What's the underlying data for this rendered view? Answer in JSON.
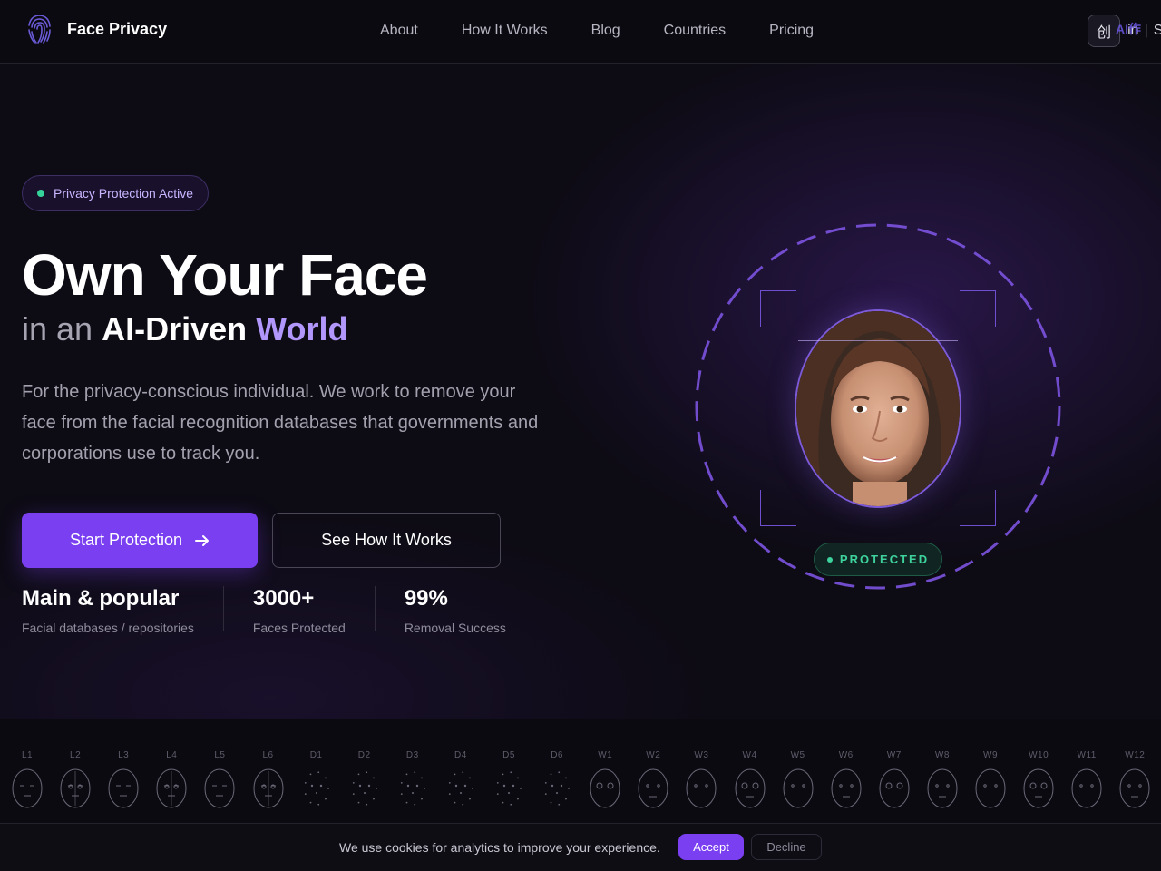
{
  "nav": {
    "brand": "Face Privacy",
    "links": [
      "About",
      "How It Works",
      "Blog",
      "Countries",
      "Pricing"
    ],
    "app_badge": "创",
    "signin": "in",
    "signup": "Sign up",
    "ai_mark": "AI作"
  },
  "hero": {
    "status": "Privacy Protection Active",
    "title": "Own Your Face",
    "subtitle_prefix": "in an",
    "subtitle_word1": "AI-Driven",
    "subtitle_word2": "World",
    "lead": "For the privacy-conscious individual. We work to remove your face from the facial recognition databases that governments and corporations use to track you.",
    "primary_cta": "Start Protection",
    "secondary_cta": "See How It Works",
    "stats": [
      {
        "value": "Main & popular",
        "label": "Facial databases / repositories"
      },
      {
        "value": "3000+",
        "label": "Faces Protected"
      },
      {
        "value": "99%",
        "label": "Removal Success"
      }
    ],
    "protected_badge": "PROTECTED"
  },
  "strip": {
    "labels": [
      "L1",
      "L2",
      "L3",
      "L4",
      "L5",
      "L6",
      "D1",
      "D2",
      "D3",
      "D4",
      "D5",
      "D6",
      "W1",
      "W2",
      "W3",
      "W4",
      "W5",
      "W6",
      "W7",
      "W8",
      "W9",
      "W10",
      "W11",
      "W12"
    ]
  },
  "cookie": {
    "text": "We use cookies for analytics to improve your experience.",
    "accept": "Accept",
    "decline": "Decline"
  },
  "colors": {
    "accent": "#7a3ff0",
    "accent_light": "#b197fc",
    "success": "#3ed29c",
    "background": "#0c0a12"
  }
}
